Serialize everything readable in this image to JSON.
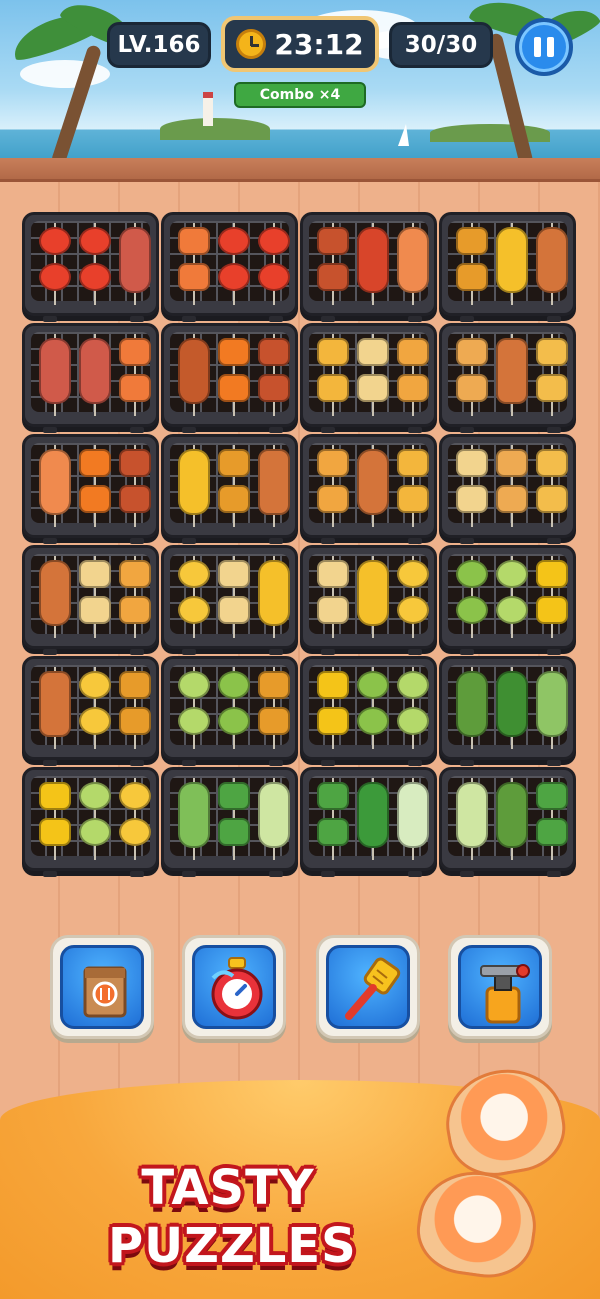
{
  "hud": {
    "level": "LV.166",
    "timer": "23:12",
    "moves": "30/30",
    "combo": "Combo ×4"
  },
  "power_ups": [
    {
      "name": "takeout-bag"
    },
    {
      "name": "stopwatch"
    },
    {
      "name": "spatula"
    },
    {
      "name": "blowtorch"
    }
  ],
  "banner": {
    "line1": "TASTY",
    "line2": "PUZZLES"
  },
  "colors": {
    "tomato": "#e8402b",
    "bacon": "#d05a4a",
    "shrimp": "#f07a3a",
    "sausage": "#c7522d",
    "lobster": "#d8452a",
    "salmon": "#f08a4e",
    "corn": "#f5c02a",
    "pumpkin": "#e79b2a",
    "hotdog": "#d4743a",
    "squid": "#c45a2b",
    "carrot": "#f27a22",
    "taco": "#f3b63c",
    "toast": "#f2d48e",
    "pizza": "#f1a640",
    "bun": "#eeaa52",
    "cake": "#f3bd4b",
    "pineapple": "#f7c83b",
    "egg": "#8bc34a",
    "cucumber": "#b4d96a",
    "pepper": "#f4c418",
    "asparagus": "#5e9c3b",
    "broccoli": "#3f8f32",
    "celery": "#8fc565",
    "lettuce": "#7fbf58",
    "edamame": "#4ea543",
    "okra": "#3c9a3a",
    "scallion": "#d8ecc0",
    "cabbage": "#cfe6a2"
  },
  "grills": [
    [
      "tomato",
      "tomato-vine",
      "bacon"
    ],
    [
      "shrimp",
      "tomato",
      "tomato-vine"
    ],
    [
      "sausage",
      "lobster",
      "salmon"
    ],
    [
      "pumpkin",
      "corn",
      "hotdog"
    ],
    [
      "bacon",
      "bacon",
      "shrimp"
    ],
    [
      "squid",
      "carrot",
      "sausage"
    ],
    [
      "taco",
      "toast",
      "pizza"
    ],
    [
      "bun",
      "hotdog-twist",
      "cake"
    ],
    [
      "salmon",
      "carrot",
      "sausage"
    ],
    [
      "corn",
      "pumpkin",
      "hotdog-twist"
    ],
    [
      "pizza",
      "hotdog",
      "taco"
    ],
    [
      "toast",
      "bun",
      "cake"
    ],
    [
      "hotdog",
      "toast",
      "pizza"
    ],
    [
      "pineapple",
      "toast",
      "corn"
    ],
    [
      "toast",
      "corn",
      "pineapple"
    ],
    [
      "egg",
      "cucumber",
      "pepper"
    ],
    [
      "hotdog-twist",
      "pineapple",
      "pumpkin"
    ],
    [
      "cucumber",
      "egg",
      "pumpkin"
    ],
    [
      "pepper",
      "egg",
      "cucumber"
    ],
    [
      "asparagus",
      "broccoli",
      "celery"
    ],
    [
      "pepper",
      "cucumber",
      "pineapple"
    ],
    [
      "lettuce",
      "edamame",
      "cabbage"
    ],
    [
      "edamame",
      "okra",
      "scallion"
    ],
    [
      "cabbage",
      "asparagus",
      "edamame"
    ]
  ]
}
